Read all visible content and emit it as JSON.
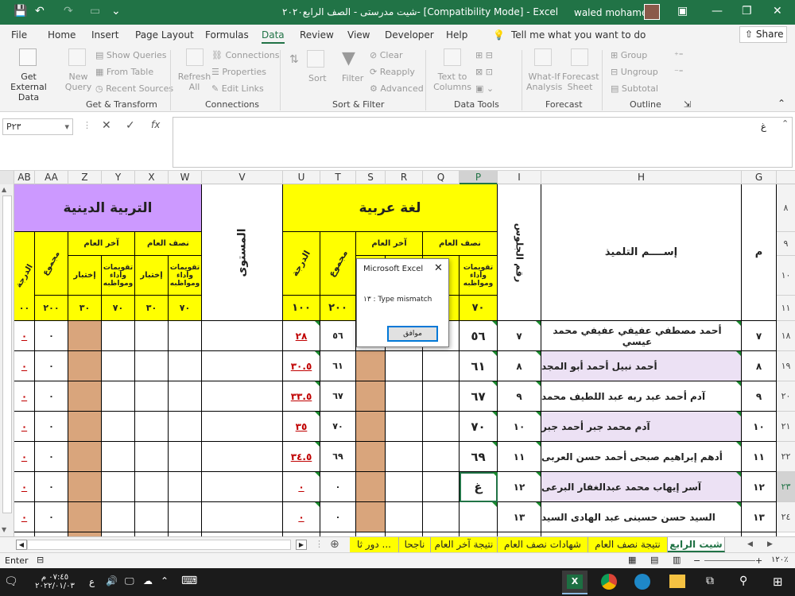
{
  "title_bar": {
    "title": "شيت مدرستى - الصف الرابع٢٠٢٠- [Compatibility Mode] - Excel",
    "user": "waled mohamed"
  },
  "menu_tabs": [
    "File",
    "Home",
    "Insert",
    "Page Layout",
    "Formulas",
    "Data",
    "Review",
    "View",
    "Developer",
    "Help"
  ],
  "tell_me": "Tell me what you want to do",
  "share": "Share",
  "ribbon": {
    "get_external_data": "Get External Data",
    "new_query": "New Query",
    "show_queries": "Show Queries",
    "from_table": "From Table",
    "recent_sources": "Recent Sources",
    "refresh_all": "Refresh All",
    "connections": "Connections",
    "properties": "Properties",
    "edit_links": "Edit Links",
    "sort": "Sort",
    "filter": "Filter",
    "clear": "Clear",
    "reapply": "Reapply",
    "advanced": "Advanced",
    "text_to_columns": "Text to Columns",
    "what_if": "What-If Analysis",
    "forecast_sheet": "Forecast Sheet",
    "group": "Group",
    "ungroup": "Ungroup",
    "subtotal": "Subtotal",
    "groups": [
      "Get & Transform",
      "Connections",
      "Sort & Filter",
      "Data Tools",
      "Forecast",
      "Outline"
    ]
  },
  "formula_bar": {
    "name_box": "P٢٣",
    "formula": "غ"
  },
  "columns": [
    "AB",
    "AA",
    "Z",
    "Y",
    "X",
    "W",
    "V",
    "U",
    "T",
    "S",
    "R",
    "Q",
    "P",
    "I",
    "H",
    "G"
  ],
  "headers": {
    "religion": "التربية الدينية",
    "arabic": "لغة عربية",
    "level": "المستوى",
    "seat_no": "رقم الجلوس",
    "student_name": "إســــم التلميذ",
    "m": "م",
    "end_year": "آخر العام",
    "mid_year": "نصف العام",
    "assessments": "تقويمات وأداء ومواظبه",
    "test": "إختبار",
    "total": "مجموع",
    "grade": "الدرجة",
    "max_70": "٧٠",
    "max_30": "٣٠",
    "max_200": "٢٠٠",
    "max_100": "١٠٠",
    "max_partial": "٠٠"
  },
  "row_headers": [
    "٨",
    "٩",
    "١٠",
    "١١",
    "١٨",
    "١٩",
    "٢٠",
    "٢١",
    "٢٢",
    "٢٣",
    "٢٤"
  ],
  "rows": [
    {
      "m": "٧",
      "name": "أحمد مصطفي عفيفي عفيفي محمد عيسي",
      "seat": "٧",
      "p": "٥٦",
      "t": "٥٦",
      "u": "٢٨",
      "aa": "٠",
      "ab": "٠"
    },
    {
      "m": "٨",
      "name": "أحمد نبيل أحمد أبو المجد",
      "seat": "٨",
      "p": "٦١",
      "t": "٦١",
      "u": "٣٠.٥",
      "aa": "٠",
      "ab": "٠"
    },
    {
      "m": "٩",
      "name": "آدم أحمد عبد ربه عبد اللطيف محمد",
      "seat": "٩",
      "p": "٦٧",
      "t": "٦٧",
      "u": "٣٣.٥",
      "aa": "٠",
      "ab": "٠"
    },
    {
      "m": "١٠",
      "name": "آدم محمد جبر أحمد جبر",
      "seat": "١٠",
      "p": "٧٠",
      "t": "٧٠",
      "u": "٣٥",
      "aa": "٠",
      "ab": "٠"
    },
    {
      "m": "١١",
      "name": "أدهم إبراهيم صبحى أحمد حسن العربى",
      "seat": "١١",
      "p": "٦٩",
      "t": "٦٩",
      "u": "٣٤.٥",
      "aa": "٠",
      "ab": "٠"
    },
    {
      "m": "١٢",
      "name": "آسر إيهاب محمد عبدالغفار البرعى",
      "seat": "١٢",
      "p": "غ",
      "t": "٠",
      "u": "٠",
      "aa": "٠",
      "ab": "٠"
    },
    {
      "m": "١٣",
      "name": "السيد حسن حسينى عبد الهادى السيد",
      "seat": "١٣",
      "p": "",
      "t": "٠",
      "u": "٠",
      "aa": "٠",
      "ab": "٠"
    }
  ],
  "dialog": {
    "title": "Microsoft Excel",
    "message": "١٣ : Type mismatch",
    "ok": "موافق"
  },
  "sheet_tabs": [
    {
      "label": "شيت الرابع",
      "active": true
    },
    {
      "label": "نتيجة نصف العام",
      "active": false
    },
    {
      "label": "شهادات نصف العام",
      "active": false
    },
    {
      "label": "نتيجة آخر العام",
      "active": false
    },
    {
      "label": "ناجحا",
      "active": false
    },
    {
      "label": "دور ثا ...",
      "active": false
    }
  ],
  "status": {
    "mode": "Enter",
    "zoom": "١٢٠٪"
  },
  "taskbar": {
    "time": "٠٧:٤٥ م",
    "date": "٢٠٢٢/٠١/٠٣",
    "lang": "ع"
  },
  "colors": {
    "excel_green": "#217346",
    "yellow": "#ffff00",
    "purple": "#cc99ff",
    "lavender": "#ece1f4",
    "tan": "#d9a57c"
  }
}
